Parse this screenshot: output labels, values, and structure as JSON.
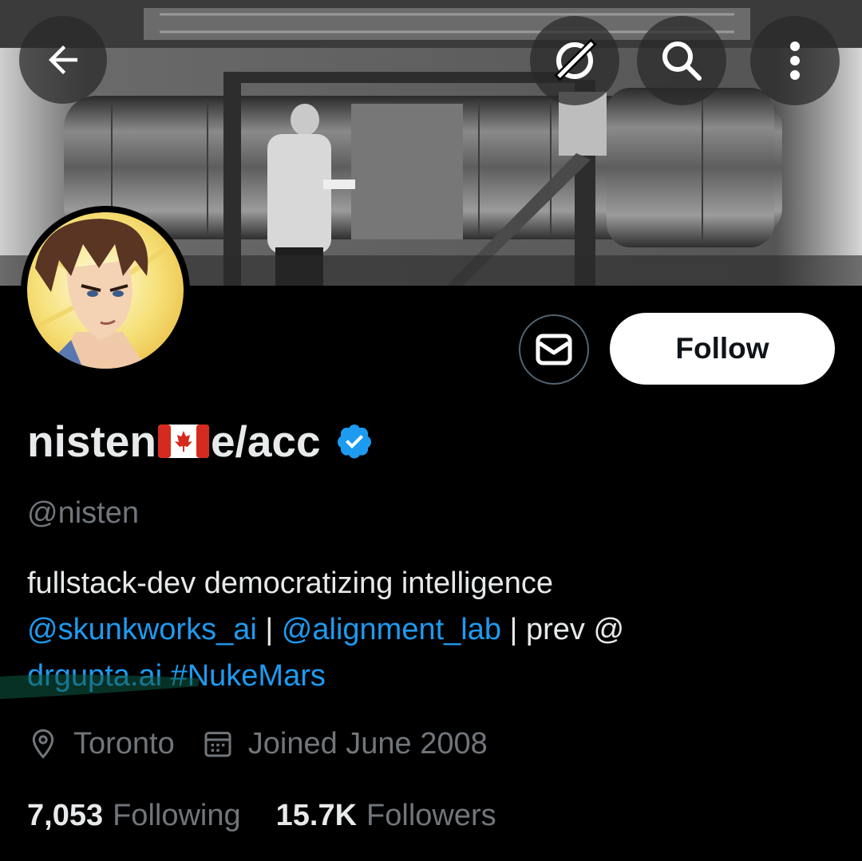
{
  "header": {
    "back_icon": "arrow-left-icon",
    "grok_icon": "grok-icon",
    "search_icon": "search-icon",
    "more_icon": "more-vertical-icon"
  },
  "profile": {
    "name_prefix": "nisten",
    "name_flag": "canada-flag",
    "name_suffix": "e/acc",
    "verified_icon": "verified-badge-icon",
    "handle": "@nisten",
    "bio": {
      "line1": "fullstack-dev democratizing intelligence",
      "mention1": "@skunkworks_ai",
      "sep1": " | ",
      "mention2": "@alignment_lab",
      "sep2": " | prev @",
      "link": "drgupta.ai",
      "hashtag": "#NukeMars"
    },
    "location": "Toronto",
    "joined": "Joined June 2008",
    "following_count": "7,053",
    "following_label": "Following",
    "followers_count": "15.7K",
    "followers_label": "Followers"
  },
  "actions": {
    "message_icon": "mail-icon",
    "follow_label": "Follow"
  },
  "colors": {
    "background": "#000000",
    "link": "#1d9bf0",
    "muted": "#71767b",
    "text": "#e7e9ea",
    "verified": "#1d9bf0"
  }
}
